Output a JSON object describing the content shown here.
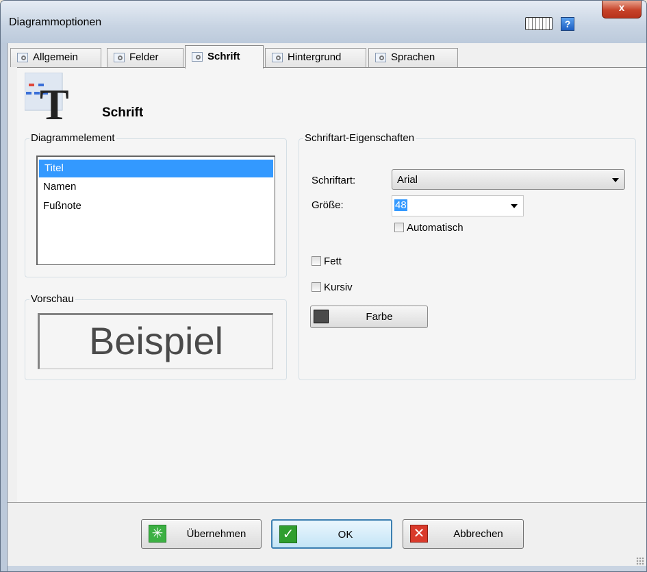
{
  "window": {
    "title": "Diagrammoptionen",
    "close_label": "x",
    "help_label": "?"
  },
  "tabs": [
    {
      "label": "Allgemein",
      "active": false
    },
    {
      "label": "Felder",
      "active": false
    },
    {
      "label": "Schrift",
      "active": true
    },
    {
      "label": "Hintergrund",
      "active": false
    },
    {
      "label": "Sprachen",
      "active": false
    }
  ],
  "page": {
    "title": "Schrift",
    "icon_letter": "T"
  },
  "diagram_element": {
    "group_label": "Diagrammelement",
    "items": [
      "Titel",
      "Namen",
      "Fußnote"
    ],
    "selected": "Titel"
  },
  "preview": {
    "group_label": "Vorschau",
    "text": "Beispiel"
  },
  "font_properties": {
    "group_label": "Schriftart-Eigenschaften",
    "font_label": "Schriftart:",
    "font_value": "Arial",
    "size_label": "Größe:",
    "size_value": "48",
    "automatic_label": "Automatisch",
    "automatic_checked": false,
    "bold_label": "Fett",
    "bold_checked": false,
    "italic_label": "Kursiv",
    "italic_checked": false,
    "color_button_label": "Farbe",
    "color_swatch": "#4b4b4b"
  },
  "footer": {
    "apply_label": "Übernehmen",
    "ok_label": "OK",
    "cancel_label": "Abbrechen"
  },
  "colors": {
    "selection": "#3399ff",
    "ok_icon": "#2f9e2f",
    "cancel_icon": "#d93a2b",
    "apply_icon": "#3cb043"
  }
}
